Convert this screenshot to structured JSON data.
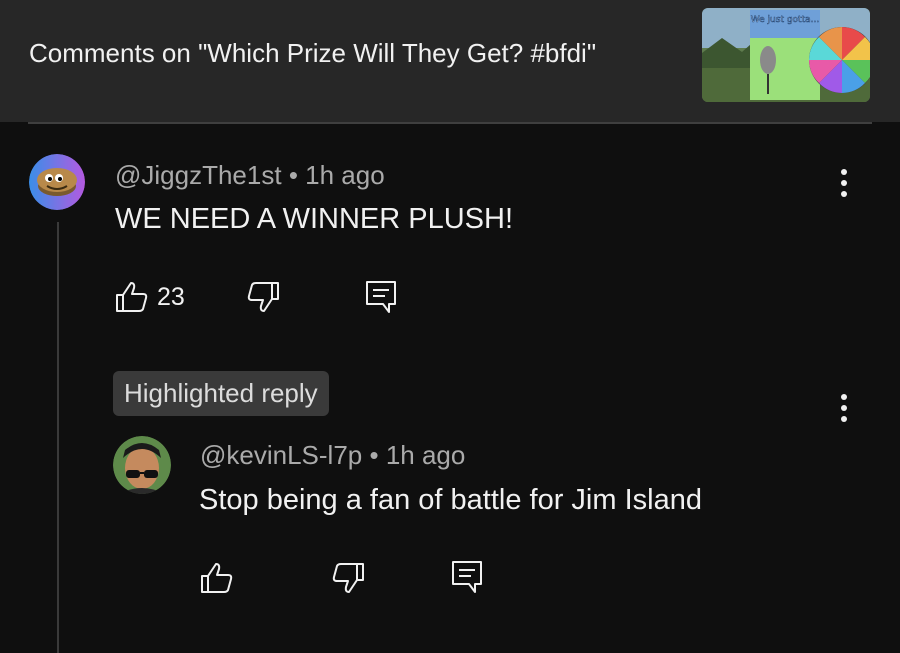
{
  "header": {
    "title": "Comments on \"Which Prize Will They Get? #bfdi\""
  },
  "thumbnail": {
    "caption": "We just gotta..."
  },
  "comment": {
    "author": "@JiggzThe1st",
    "separator": "•",
    "time": "1h ago",
    "text": "WE NEED A WINNER PLUSH!",
    "like_count": "23"
  },
  "reply": {
    "badge": "Highlighted reply",
    "author": "@kevinLS-l7p",
    "separator": "•",
    "time": "1h ago",
    "text": "Stop being a fan of battle for Jim Island"
  },
  "icons": {
    "like": "thumb-up-icon",
    "dislike": "thumb-down-icon",
    "reply": "comment-icon",
    "menu": "more-vert-icon"
  }
}
